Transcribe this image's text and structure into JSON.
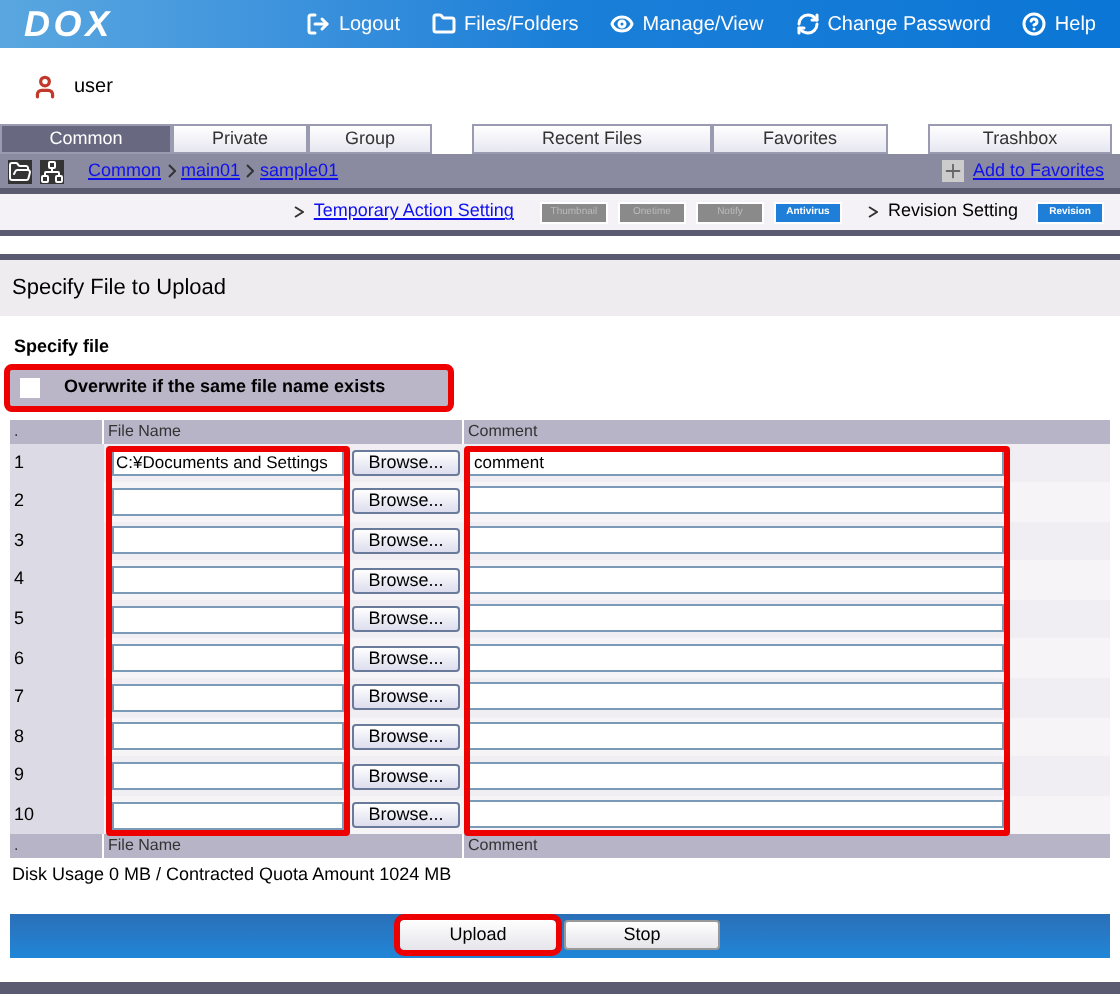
{
  "header": {
    "logo": "DOX",
    "nav": [
      "Logout",
      "Files/Folders",
      "Manage/View",
      "Change Password",
      "Help"
    ]
  },
  "user": "user",
  "tabs": [
    {
      "label": "Common",
      "selected": true
    },
    {
      "label": "Private",
      "selected": false
    },
    {
      "label": "Group",
      "selected": false
    },
    {
      "label": "Recent Files",
      "selected": false
    },
    {
      "label": "Favorites",
      "selected": false
    },
    {
      "label": "Trashbox",
      "selected": false
    }
  ],
  "breadcrumb": [
    "Common",
    "main01",
    "sample01"
  ],
  "add_favorites": "Add to Favorites",
  "action_bar": {
    "temporary_link": "Temporary Action Setting",
    "temporary_buttons": [
      {
        "label": "Thumbnail",
        "disabled": true
      },
      {
        "label": "Onetime",
        "disabled": true
      },
      {
        "label": "Notify",
        "disabled": true
      },
      {
        "label": "Antivirus",
        "disabled": false
      }
    ],
    "revision_label": "Revision Setting",
    "revision_button": {
      "label": "Revision",
      "disabled": false
    }
  },
  "section_title": "Specify File to Upload",
  "subtitle": "Specify file",
  "overwrite": {
    "label": "Overwrite if the same file name exists",
    "checked": false,
    "highlighted": true
  },
  "table": {
    "columns": [
      ".",
      "File Name",
      "Comment"
    ],
    "file_column_highlighted": true,
    "comment_column_highlighted": true,
    "rows": [
      {
        "number": "1",
        "file": "C:¥Documents and Settings",
        "browse": "Browse...",
        "comment": "comment"
      },
      {
        "number": "2",
        "browse": "Browse..."
      },
      {
        "number": "3",
        "browse": "Browse..."
      },
      {
        "number": "4",
        "browse": "Browse..."
      },
      {
        "number": "5",
        "browse": "Browse..."
      },
      {
        "number": "6",
        "browse": "Browse..."
      },
      {
        "number": "7",
        "browse": "Browse..."
      },
      {
        "number": "8",
        "browse": "Browse..."
      },
      {
        "number": "9",
        "browse": "Browse..."
      },
      {
        "number": "10",
        "browse": "Browse..."
      }
    ],
    "footer_columns": [
      ".",
      "File Name",
      "Comment"
    ]
  },
  "disk_usage": "Disk Usage 0 MB / Contracted Quota Amount 1024 MB",
  "buttons": [
    {
      "label": "Upload",
      "highlighted": true
    },
    {
      "label": "Stop",
      "highlighted": false
    }
  ]
}
